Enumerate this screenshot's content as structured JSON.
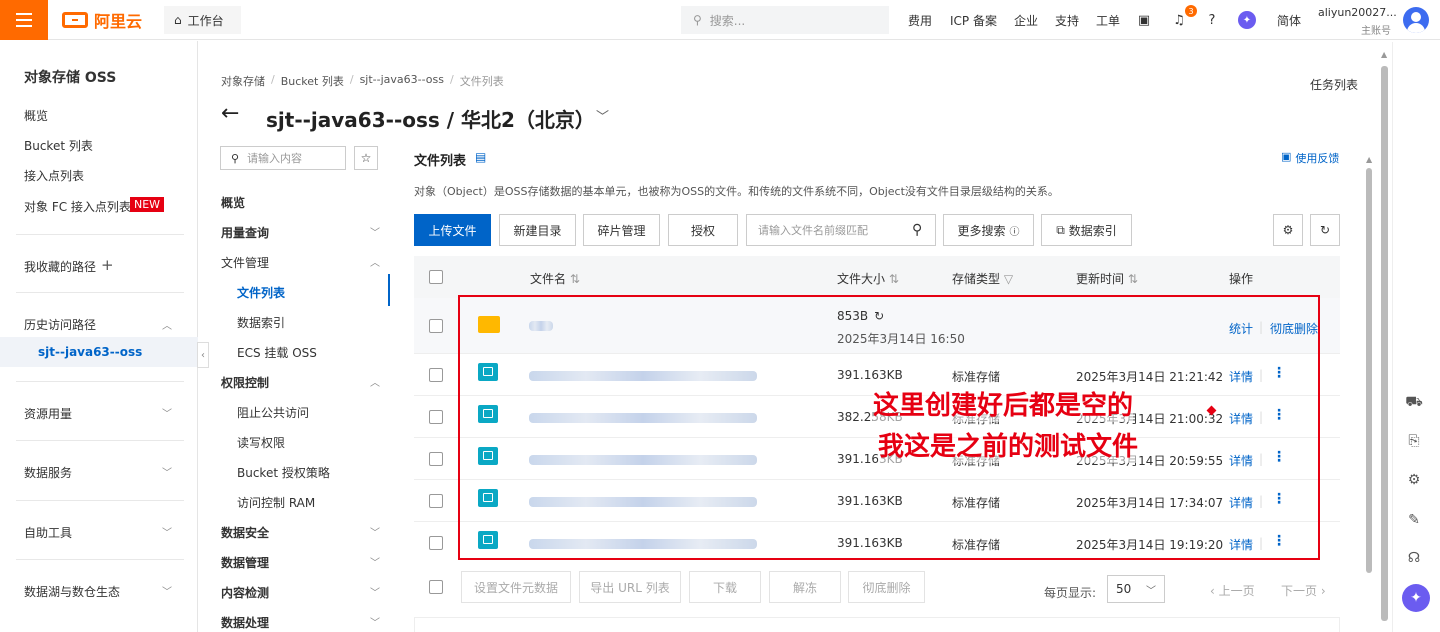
{
  "topbar": {
    "logo_text": "阿里云",
    "workbench": "工作台",
    "search_placeholder": "搜索...",
    "nav": [
      "费用",
      "ICP 备案",
      "企业",
      "支持",
      "工单"
    ],
    "badge_count": "3",
    "lang": "简体",
    "user_name": "aliyun20027...",
    "user_role": "主账号"
  },
  "sidebar": {
    "title": "对象存储 OSS",
    "items": [
      "概览",
      "Bucket 列表",
      "接入点列表",
      "对象 FC 接入点列表"
    ],
    "new_badge": "NEW",
    "favorites": "我收藏的路径",
    "history": "历史访问路径",
    "history_item": "sjt--java63--oss",
    "groups": [
      "资源用量",
      "数据服务",
      "自助工具",
      "数据湖与数仓生态"
    ]
  },
  "header": {
    "breadcrumb": [
      "对象存储",
      "Bucket 列表",
      "sjt--java63--oss",
      "文件列表"
    ],
    "title": "sjt--java63--oss / 华北2（北京）",
    "task_list": "任务列表"
  },
  "midnav": {
    "search_placeholder": "请输入内容",
    "items": [
      {
        "label": "概览",
        "bold": true
      },
      {
        "label": "用量查询",
        "bold": true
      },
      {
        "label": "文件管理",
        "bold": false
      },
      {
        "label": "文件列表",
        "bold": true,
        "active": true
      },
      {
        "label": "数据索引",
        "bold": false
      },
      {
        "label": "ECS 挂载 OSS",
        "bold": false
      },
      {
        "label": "权限控制",
        "bold": true
      },
      {
        "label": "阻止公共访问",
        "bold": false
      },
      {
        "label": "读写权限",
        "bold": false
      },
      {
        "label": "Bucket 授权策略",
        "bold": false
      },
      {
        "label": "访问控制 RAM",
        "bold": false
      },
      {
        "label": "数据安全",
        "bold": true
      },
      {
        "label": "数据管理",
        "bold": true
      },
      {
        "label": "内容检测",
        "bold": true
      },
      {
        "label": "数据处理",
        "bold": true
      }
    ]
  },
  "filelist": {
    "title": "文件列表",
    "feedback": "使用反馈",
    "description": "对象（Object）是OSS存储数据的基本单元，也被称为OSS的文件。和传统的文件系统不同，Object没有文件目录层级结构的关系。",
    "toolbar": {
      "upload": "上传文件",
      "new_dir": "新建目录",
      "fragments": "碎片管理",
      "authorize": "授权",
      "search_placeholder": "请输入文件名前缀匹配",
      "more_search": "更多搜索",
      "data_index": "数据索引"
    },
    "columns": [
      "文件名",
      "文件大小",
      "存储类型",
      "更新时间",
      "操作"
    ],
    "folder_row": {
      "size": "853B",
      "date": "2025年3月14日 16:50",
      "actions": [
        "统计",
        "彻底删除"
      ]
    },
    "rows": [
      {
        "size": "391.163KB",
        "type": "标准存储",
        "time": "2025年3月14日 21:21:42",
        "action": "详情"
      },
      {
        "size": "382.258KB",
        "type": "标准存储",
        "time": "2025年3月14日 21:00:32",
        "action": "详情"
      },
      {
        "size": "391.163KB",
        "type": "标准存储",
        "time": "2025年3月14日 20:59:55",
        "action": "详情"
      },
      {
        "size": "391.163KB",
        "type": "标准存储",
        "time": "2025年3月14日 17:34:07",
        "action": "详情"
      },
      {
        "size": "391.163KB",
        "type": "标准存储",
        "time": "2025年3月14日 19:19:20",
        "action": "详情"
      }
    ],
    "annotation": [
      "这里创建好后都是空的",
      "我这是之前的测试文件"
    ],
    "bottom_actions": [
      "设置文件元数据",
      "导出 URL 列表",
      "下载",
      "解冻",
      "彻底删除"
    ],
    "page_size_label": "每页显示:",
    "page_size": "50",
    "prev": "上一页",
    "next": "下一页"
  },
  "colors": {
    "brand": "#ff6a00",
    "primary": "#0064c8",
    "annotation": "#e60012"
  }
}
